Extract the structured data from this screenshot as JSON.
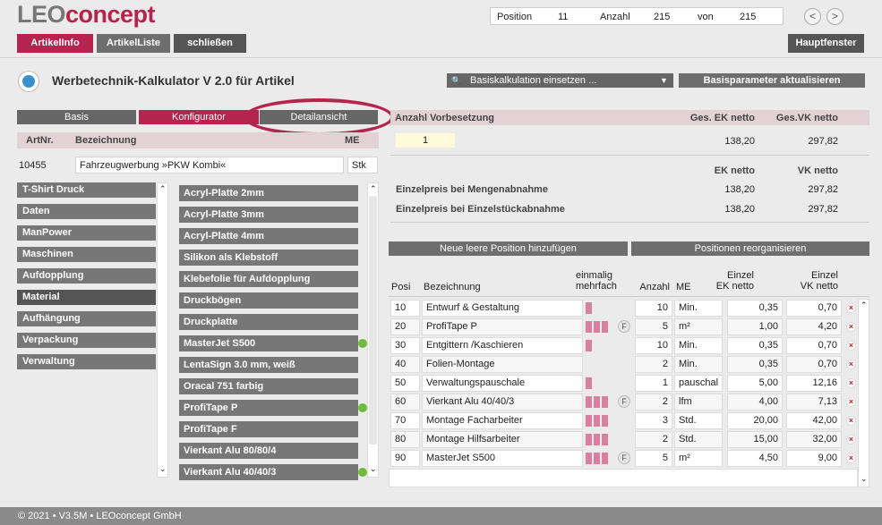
{
  "logo": {
    "part1": "LEO",
    "part2": "concept"
  },
  "nav": {
    "position_label": "Position",
    "position": "11",
    "anzahl_label": "Anzahl",
    "anzahl": "215",
    "von_label": "von",
    "von": "215",
    "prev": "<",
    "next": ">"
  },
  "tabs": {
    "artikelinfo": "ArtikelInfo",
    "artikelliste": "ArtikelListe",
    "schliessen": "schließen",
    "hauptfenster": "Hauptfenster"
  },
  "title": "Werbetechnik-Kalkulator V 2.0 für Artikel",
  "dropdown": {
    "label": "Basiskalkulation einsetzen ...",
    "arrow": "▼",
    "icon": "🔍"
  },
  "basisparameter": "Basisparameter aktualisieren",
  "subtabs": {
    "basis": "Basis",
    "konfigurator": "Konfigurator",
    "detailansicht": "Detailansicht"
  },
  "article": {
    "artnr_label": "ArtNr.",
    "bez_label": "Bezeichnung",
    "me_label": "ME",
    "artnr": "10455",
    "bezeichnung": "Fahrzeugwerbung »PKW Kombi«",
    "me": "Stk"
  },
  "categories": [
    "T-Shirt Druck",
    "Daten",
    "ManPower",
    "Maschinen",
    "Aufdopplung",
    "Material",
    "Aufhängung",
    "Verpackung",
    "Verwaltung"
  ],
  "items": [
    "Acryl-Platte 2mm",
    "Acryl-Platte 3mm",
    "Acryl-Platte 4mm",
    "Silikon als Klebstoff",
    "Klebefolie für Aufdopplung",
    "Druckbögen",
    "Druckplatte",
    "MasterJet S500",
    "LentaSign 3.0 mm, weiß",
    "Oracal 751 farbig",
    "ProfiTape P",
    "ProfiTape F",
    "Vierkant Alu 80/80/4",
    "Vierkant Alu 40/40/3"
  ],
  "scroll": {
    "up": "⌃",
    "down": "⌄"
  },
  "summary": {
    "anzahl_label": "Anzahl Vorbesetzung",
    "ges_ek_label": "Ges. EK netto",
    "ges_vk_label": "Ges.VK netto",
    "anzahl": "1",
    "ges_ek": "138,20",
    "ges_vk": "297,82",
    "ek_label": "EK netto",
    "vk_label": "VK netto",
    "menge_label": "Einzelpreis bei Mengenabnahme",
    "menge_ek": "138,20",
    "menge_vk": "297,82",
    "einzel_label": "Einzelpreis bei Einzelstückabnahme",
    "einzel_ek": "138,20",
    "einzel_vk": "297,82"
  },
  "actions": {
    "neue": "Neue leere Position hinzufügen",
    "reorg": "Positionen reorganisieren"
  },
  "table": {
    "headers": {
      "posi": "Posi",
      "bez": "Bezeichnung",
      "einmalig": "einmalig",
      "mehrfach": "mehrfach",
      "anzahl": "Anzahl",
      "me": "ME",
      "ek1": "Einzel",
      "ek2": "EK netto",
      "vk1": "Einzel",
      "vk2": "VK netto"
    },
    "f_label": "F",
    "del_label": "×",
    "rows": [
      {
        "posi": "10",
        "bez": "Entwurf & Gestaltung",
        "bars": 1,
        "f": false,
        "anzahl": "10",
        "me": "Min.",
        "ek": "0,35",
        "vk": "0,70"
      },
      {
        "posi": "20",
        "bez": "ProfiTape P",
        "bars": 3,
        "f": true,
        "anzahl": "5",
        "me": "m²",
        "ek": "1,00",
        "vk": "4,20"
      },
      {
        "posi": "30",
        "bez": "Entgittern /Kaschieren",
        "bars": 1,
        "f": false,
        "anzahl": "10",
        "me": "Min.",
        "ek": "0,35",
        "vk": "0,70"
      },
      {
        "posi": "40",
        "bez": "Folien-Montage",
        "bars": 0,
        "f": false,
        "anzahl": "2",
        "me": "Min.",
        "ek": "0,35",
        "vk": "0,70"
      },
      {
        "posi": "50",
        "bez": "Verwaltungspauschale",
        "bars": 1,
        "f": false,
        "anzahl": "1",
        "me": "pauschal",
        "ek": "5,00",
        "vk": "12,16"
      },
      {
        "posi": "60",
        "bez": "Vierkant Alu 40/40/3",
        "bars": 3,
        "f": true,
        "anzahl": "2",
        "me": "lfm",
        "ek": "4,00",
        "vk": "7,13"
      },
      {
        "posi": "70",
        "bez": "Montage Facharbeiter",
        "bars": 3,
        "f": false,
        "anzahl": "3",
        "me": "Std.",
        "ek": "20,00",
        "vk": "42,00"
      },
      {
        "posi": "80",
        "bez": "Montage Hilfsarbeiter",
        "bars": 3,
        "f": false,
        "anzahl": "2",
        "me": "Std.",
        "ek": "15,00",
        "vk": "32,00"
      },
      {
        "posi": "90",
        "bez": "MasterJet S500",
        "bars": 3,
        "f": true,
        "anzahl": "5",
        "me": "m²",
        "ek": "4,50",
        "vk": "9,00"
      }
    ]
  },
  "footer": "© 2021 • V3.5M • LEOconcept GmbH"
}
